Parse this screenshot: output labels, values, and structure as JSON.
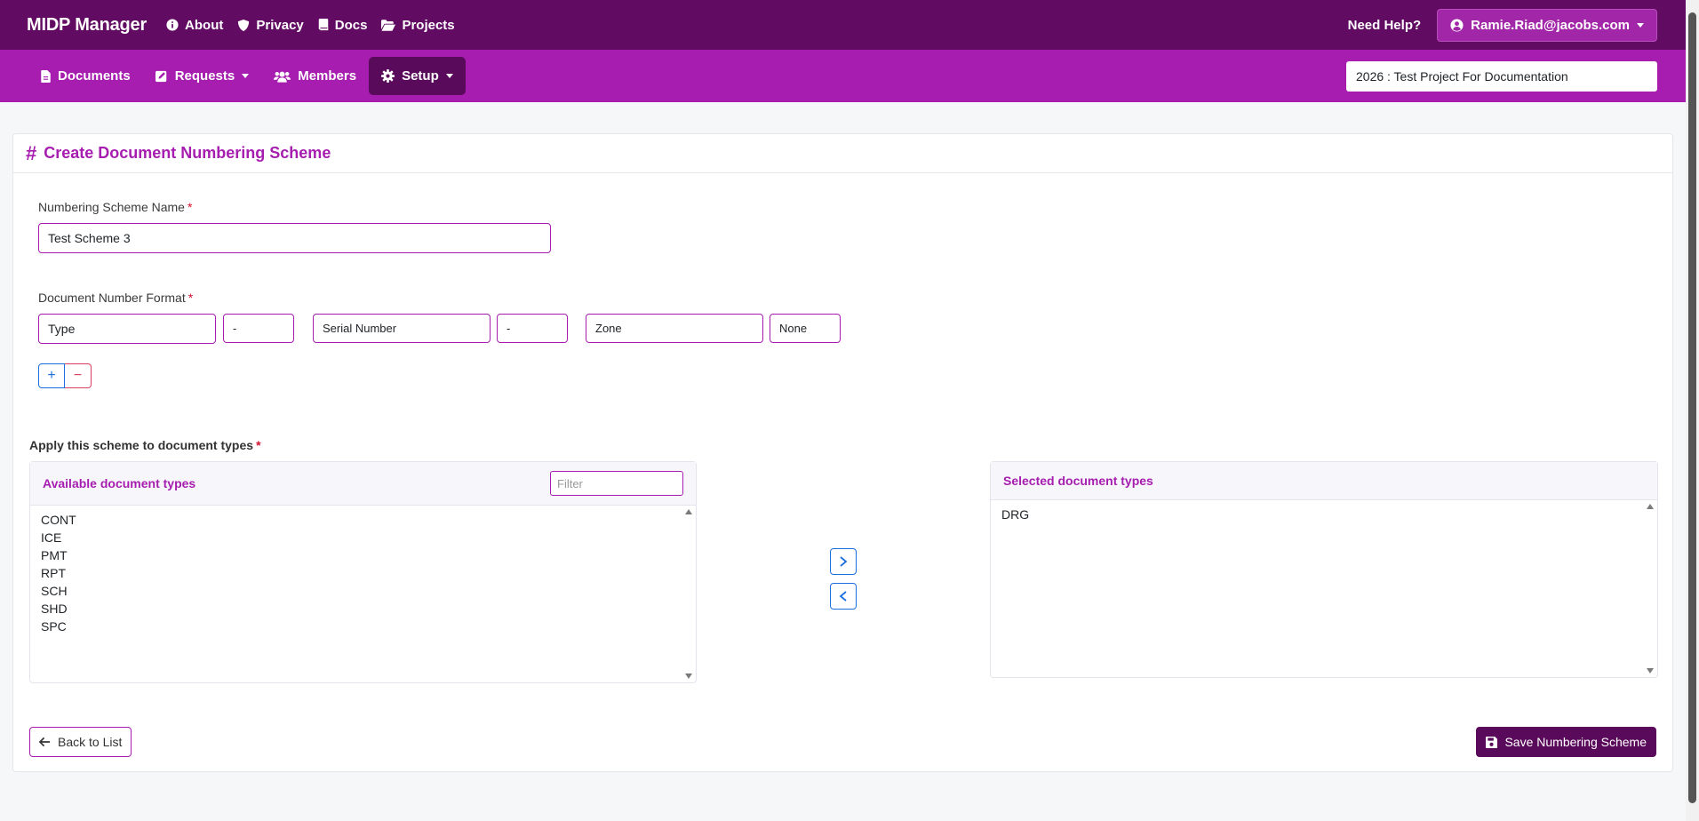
{
  "topbar": {
    "brand": "MIDP Manager",
    "nav": [
      {
        "label": "About",
        "icon": "info-circle-icon"
      },
      {
        "label": "Privacy",
        "icon": "shield-icon"
      },
      {
        "label": "Docs",
        "icon": "book-icon"
      },
      {
        "label": "Projects",
        "icon": "folder-open-icon"
      }
    ],
    "help": "Need Help?",
    "user": "Ramie.Riad@jacobs.com"
  },
  "subbar": {
    "nav": [
      {
        "label": "Documents",
        "icon": "file-icon"
      },
      {
        "label": "Requests",
        "icon": "edit-square-icon"
      },
      {
        "label": "Members",
        "icon": "users-icon"
      },
      {
        "label": "Setup",
        "icon": "gear-icon"
      }
    ],
    "project": "2026 : Test Project For Documentation"
  },
  "form": {
    "title": "Create Document Numbering Scheme",
    "name_label": "Numbering Scheme Name",
    "name_value": "Test Scheme 3",
    "format_label": "Document Number Format",
    "format_parts": [
      "Type",
      "-",
      "Serial Number",
      "-",
      "Zone",
      "None"
    ],
    "plus": "+",
    "minus": "−",
    "required_mark": "*",
    "apply_label": "Apply this scheme to document types"
  },
  "available": {
    "title": "Available document types",
    "filter_placeholder": "Filter",
    "items": [
      "CONT",
      "ICE",
      "PMT",
      "RPT",
      "SCH",
      "SHD",
      "SPC"
    ]
  },
  "selected": {
    "title": "Selected document types",
    "items": [
      "DRG"
    ]
  },
  "actions": {
    "back": "Back to List",
    "save": "Save Numbering Scheme"
  },
  "colors": {
    "topbar": "#620b63",
    "subbar": "#a61daf",
    "accent": "#a61daf",
    "save": "#5a0a5b"
  }
}
